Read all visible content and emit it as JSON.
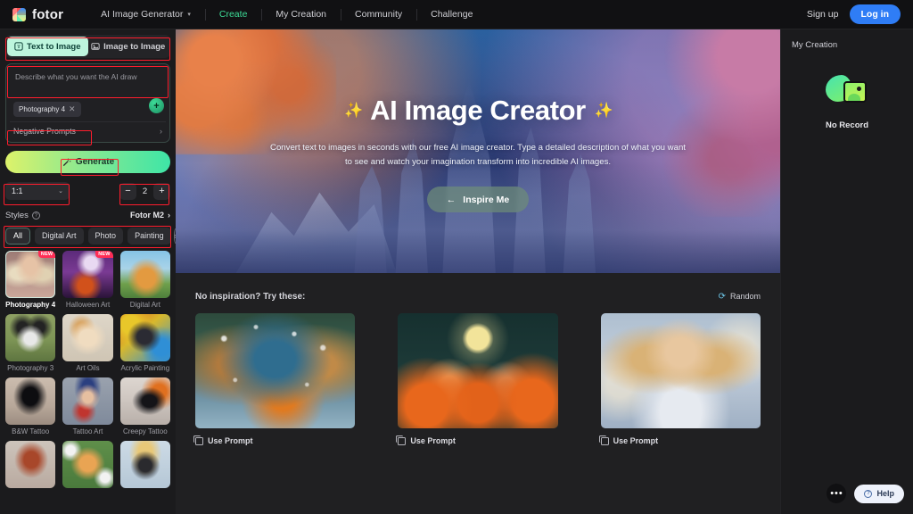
{
  "header": {
    "brand": "fotor",
    "nav": [
      {
        "label": "AI Image Generator",
        "active": false,
        "caret": "▾"
      },
      {
        "label": "Create",
        "active": true
      },
      {
        "label": "My Creation",
        "active": false
      },
      {
        "label": "Community",
        "active": false
      },
      {
        "label": "Challenge",
        "active": false
      }
    ],
    "signup_label": "Sign up",
    "login_label": "Log in",
    "accent_active": "#3ddc97",
    "login_bg": "#2f7df6"
  },
  "left_panel": {
    "mode_tabs": [
      {
        "label": "Text to Image",
        "icon": "text-to-image-icon",
        "active": true
      },
      {
        "label": "Image to Image",
        "icon": "image-to-image-icon",
        "active": false
      }
    ],
    "prompt": {
      "placeholder": "Describe what you want the AI draw",
      "value": "",
      "tag": "Photography 4",
      "tag_remove": "✕",
      "add_label": "+",
      "negative_label": "Negative Prompts",
      "negative_arrow": "›"
    },
    "generate_label": "Generate",
    "generate_icon": "magic-wand-icon",
    "aspect_ratio": {
      "value": "1:1",
      "caret": "⌄"
    },
    "count": {
      "minus": "−",
      "value": "2",
      "plus": "+"
    },
    "styles": {
      "title": "Styles",
      "help_icon": "question-mark-icon",
      "model": "Fotor M2",
      "model_arrow": "›",
      "chips": [
        {
          "label": "All",
          "active": true
        },
        {
          "label": "Digital Art",
          "active": false
        },
        {
          "label": "Photo",
          "active": false
        },
        {
          "label": "Painting",
          "active": false
        }
      ],
      "chips_next": "›",
      "items": [
        {
          "label": "Photography 4",
          "badge": "NEW",
          "selected": true,
          "art": "woman-blonde"
        },
        {
          "label": "Halloween Art",
          "badge": "NEW",
          "selected": false,
          "art": "halloween-pumpkin"
        },
        {
          "label": "Digital Art",
          "badge": "",
          "selected": false,
          "art": "shiba-mountain"
        },
        {
          "label": "Photography 3",
          "badge": "",
          "selected": false,
          "art": "husky-photo"
        },
        {
          "label": "Art Oils",
          "badge": "",
          "selected": false,
          "art": "puppy-oil"
        },
        {
          "label": "Acrylic Painting",
          "badge": "",
          "selected": false,
          "art": "dog-acrylic"
        },
        {
          "label": "B&W Tattoo",
          "badge": "",
          "selected": false,
          "art": "cat-tattoo"
        },
        {
          "label": "Tattoo Art",
          "badge": "",
          "selected": false,
          "art": "girl-tattoo"
        },
        {
          "label": "Creepy Tattoo",
          "badge": "",
          "selected": false,
          "art": "crow-tattoo"
        },
        {
          "label": "",
          "badge": "",
          "selected": false,
          "art": "dog-tattoo-partial"
        },
        {
          "label": "",
          "badge": "",
          "selected": false,
          "art": "shiba-floral-partial"
        },
        {
          "label": "",
          "badge": "",
          "selected": false,
          "art": "dog-gold-partial"
        }
      ]
    }
  },
  "hero": {
    "title": "AI Image Creator",
    "spark_left": "✨",
    "spark_right": "✨",
    "subtitle": "Convert text to images in seconds with our free AI image creator. Type a detailed description of what you want to see and watch your imagination transform into incredible AI images.",
    "cta_label": "Inspire Me",
    "cta_arrow": "←"
  },
  "inspiration": {
    "title": "No inspiration? Try these:",
    "random_label": "Random",
    "random_icon": "refresh-icon",
    "cards": [
      {
        "art": "kingfisher-splash",
        "use_prompt": "Use Prompt"
      },
      {
        "art": "halloween-shibas-pumpkins",
        "use_prompt": "Use Prompt"
      },
      {
        "art": "blonde-woman-light-ribbons",
        "use_prompt": "Use Prompt"
      }
    ]
  },
  "right_panel": {
    "title": "My Creation",
    "empty_text": "No Record",
    "empty_icon": "empty-gallery-icon"
  },
  "floating": {
    "more_label": "•••",
    "help_label": "Help",
    "help_icon": "question-circle-icon"
  }
}
